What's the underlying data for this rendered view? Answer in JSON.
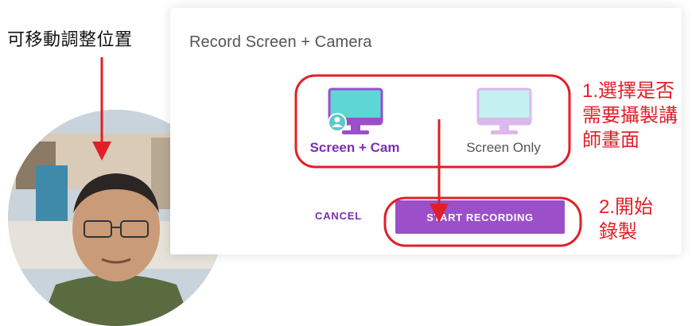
{
  "top_label": "可移動調整位置",
  "dialog": {
    "title": "Record Screen + Camera",
    "options": [
      {
        "label": "Screen + Cam",
        "icon": "monitor-with-camera-icon",
        "selected": true
      },
      {
        "label": "Screen Only",
        "icon": "monitor-icon",
        "selected": false
      }
    ],
    "cancel_label": "CANCEL",
    "start_label": "START RECORDING"
  },
  "annotations": {
    "step1": [
      "1.選擇是否",
      "需要攝製講",
      "師畫面"
    ],
    "step2": [
      "2.開始",
      "錄製"
    ]
  },
  "colors": {
    "accent": "#9b4fc8",
    "annotation_red": "#e11f27",
    "monitor_teal": "#5ed6d6",
    "monitor_purple": "#9b4fc8"
  }
}
